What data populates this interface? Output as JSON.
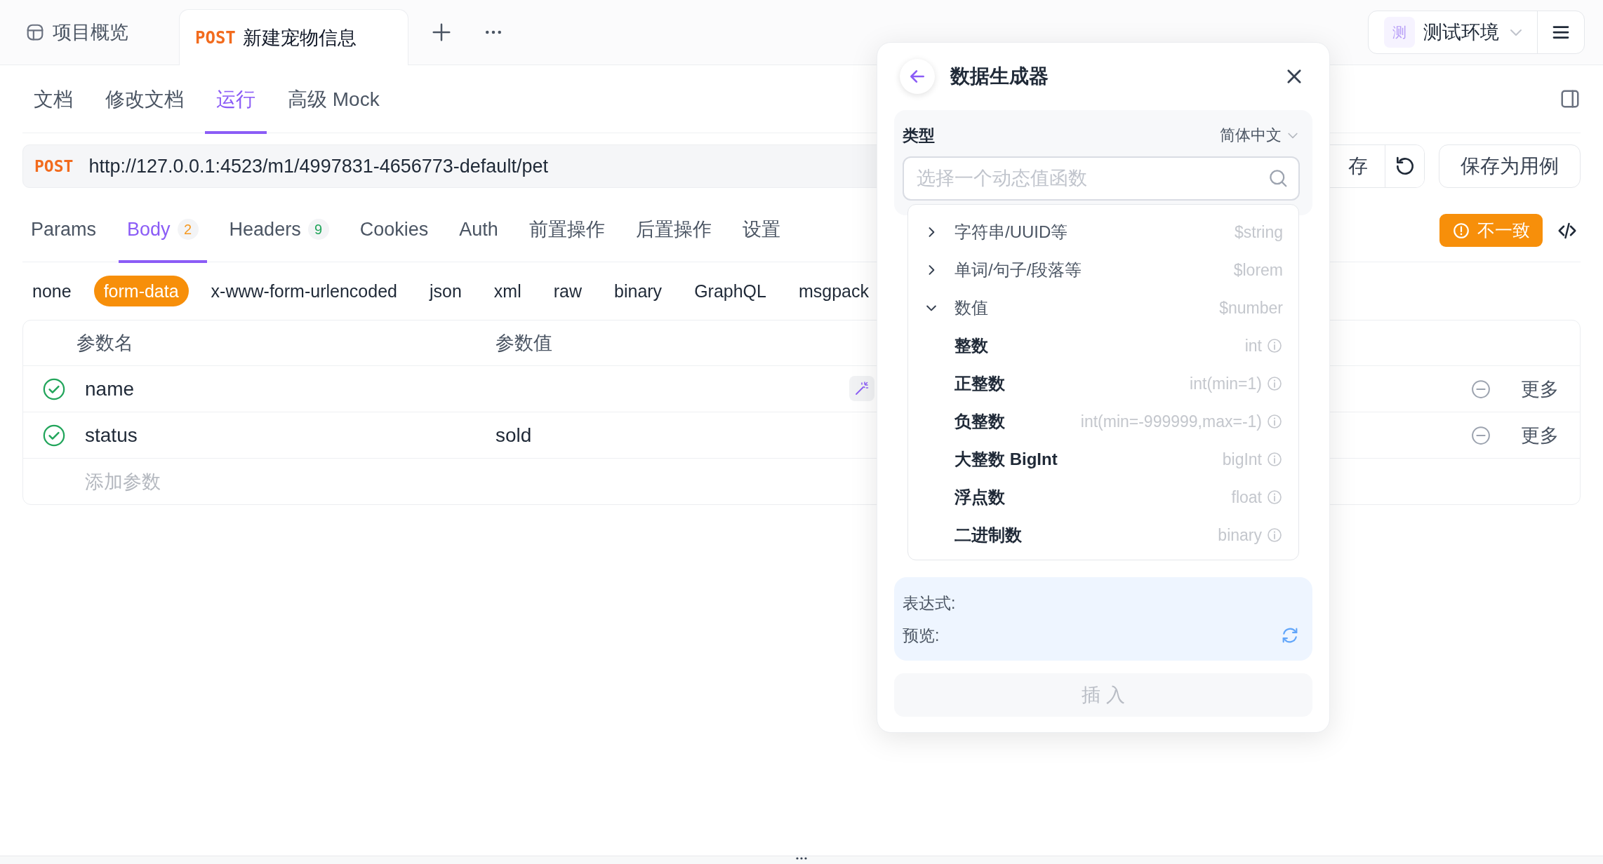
{
  "open_tabs": [
    {
      "kind": "overview",
      "label": "项目概览",
      "selected": false
    },
    {
      "kind": "request",
      "method": "POST",
      "label": "新建宠物信息",
      "selected": true
    }
  ],
  "environment": {
    "badge": "测",
    "name": "测试环境"
  },
  "view_tabs": [
    {
      "label": "文档",
      "selected": false
    },
    {
      "label": "修改文档",
      "selected": false
    },
    {
      "label": "运行",
      "selected": true
    },
    {
      "label": "高级 Mock",
      "selected": false
    }
  ],
  "request": {
    "method": "POST",
    "url": "http://127.0.0.1:4523/m1/4997831-4656773-default/pet",
    "save_button": "存",
    "save_case_button": "保存为用例"
  },
  "request_tabs": [
    {
      "label": "Params",
      "selected": false
    },
    {
      "label": "Body",
      "count": "2",
      "color": "#f59a23",
      "selected": true
    },
    {
      "label": "Headers",
      "count": "9",
      "color": "#22a55b",
      "selected": false
    },
    {
      "label": "Cookies",
      "selected": false
    },
    {
      "label": "Auth",
      "selected": false
    },
    {
      "label": "前置操作",
      "selected": false
    },
    {
      "label": "后置操作",
      "selected": false
    },
    {
      "label": "设置",
      "selected": false
    }
  ],
  "mismatch_button": "不一致",
  "body_types": [
    {
      "label": "none",
      "selected": false
    },
    {
      "label": "form-data",
      "selected": true
    },
    {
      "label": "x-www-form-urlencoded",
      "selected": false
    },
    {
      "label": "json",
      "selected": false
    },
    {
      "label": "xml",
      "selected": false
    },
    {
      "label": "raw",
      "selected": false
    },
    {
      "label": "binary",
      "selected": false
    },
    {
      "label": "GraphQL",
      "selected": false
    },
    {
      "label": "msgpack",
      "selected": false
    }
  ],
  "params_table": {
    "columns": [
      "参数名",
      "参数值"
    ],
    "rows": [
      {
        "enabled": true,
        "name": "name",
        "action": "更多"
      },
      {
        "enabled": true,
        "name": "status",
        "value": "sold",
        "action": "更多"
      }
    ],
    "add_placeholder": "添加参数"
  },
  "generator": {
    "title": "数据生成器",
    "type_label": "类型",
    "language": "简体中文",
    "search_placeholder": "选择一个动态值函数",
    "functions": [
      {
        "label": "字符串/UUID等",
        "expr": "$string",
        "expanded": false
      },
      {
        "label": "单词/句子/段落等",
        "expr": "$lorem",
        "expanded": false
      },
      {
        "label": "数值",
        "expr": "$number",
        "expanded": true,
        "children": [
          {
            "label": "整数",
            "expr": "int"
          },
          {
            "label": "正整数",
            "expr": "int(min=1)"
          },
          {
            "label": "负整数",
            "expr": "int(min=-999999,max=-1)"
          },
          {
            "label": "大整数 BigInt",
            "expr": "bigInt"
          },
          {
            "label": "浮点数",
            "expr": "float"
          },
          {
            "label": "二进制数",
            "expr": "binary"
          }
        ]
      }
    ],
    "expression_label": "表达式:",
    "preview_label": "预览:",
    "insert_button": "插 入",
    "insert_disabled": true
  }
}
